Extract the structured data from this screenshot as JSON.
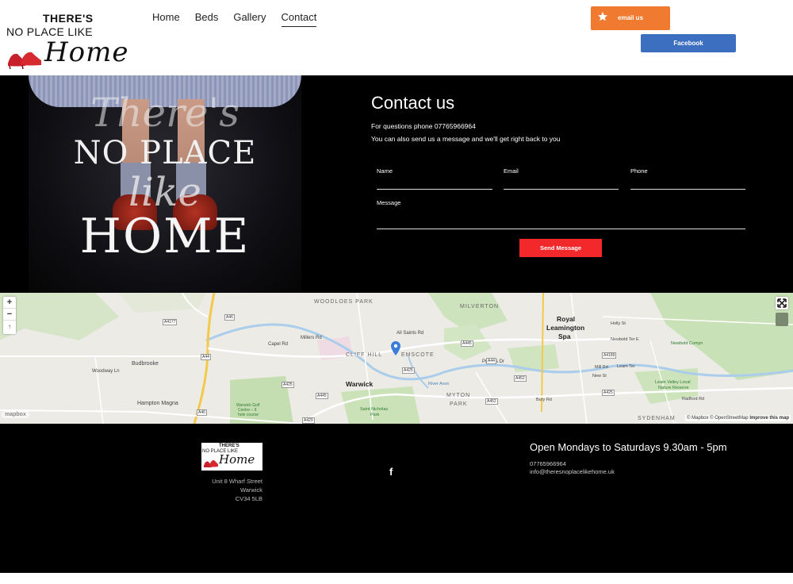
{
  "logo": {
    "line1": "THERE'S",
    "line2": "NO PLACE LIKE",
    "line3": "Home"
  },
  "nav": {
    "items": [
      "Home",
      "Beds",
      "Gallery",
      "Contact"
    ],
    "active": "Contact"
  },
  "header_buttons": {
    "email": "email us",
    "facebook": "Facebook"
  },
  "hero_text": {
    "line1": "There's",
    "line2": "NO PLACE",
    "line3": "like",
    "line4": "HOME"
  },
  "contact": {
    "title": "Contact us",
    "line1": "For questions phone 07765966964",
    "line2": "You can also send us a message and we'll get right back to you",
    "fields": {
      "name": "Name",
      "email": "Email",
      "phone": "Phone",
      "message": "Message"
    },
    "send": "Send Message"
  },
  "map": {
    "places": {
      "woodloes": "WOODLOES PARK",
      "milverton": "MILVERTON",
      "royal": "Royal",
      "leamington": "Leamington",
      "spa": "Spa",
      "cliffhill": "CLIFF HILL",
      "emscote": "EMSCOTE",
      "warwick": "Warwick",
      "budbrooke": "Budbrooke",
      "hamptonmagna": "Hampton Magna",
      "myton": "MYTON",
      "park": "PARK",
      "sydenham": "SYDENHAM",
      "newboldcomyn": "Newbold Comyn",
      "leamvalley": "Leam Valley Local",
      "naturereserve": "Nature Reserve",
      "stnicholas": "Saint Nicholas",
      "stnicholas2": "Park",
      "warwickgolf": "Warwick Golf",
      "warwickgolf2": "Centre – 9",
      "warwickgolf3": "hole course",
      "millersrd": "Millers Rd",
      "capelrd": "Capel Rd",
      "allsaintsrd": "All Saints Rd",
      "princesdr": "Princes Dr",
      "woodloesln": "Woodway Ln",
      "hollyst": "Holly St",
      "newboldterr": "Newbold Ter E",
      "millrd": "Mill Rd",
      "leamterr": "Leam Ter",
      "newst": "New St",
      "buryrd": "Bury Rd",
      "radfordrd": "Radford Rd",
      "riverleam": "River Avon"
    },
    "shields": [
      "A4177",
      "A46",
      "A445",
      "A4189",
      "A425",
      "A452",
      "A44",
      "A429",
      "A46",
      "A452",
      "A445",
      "A425",
      "A425",
      "A44"
    ],
    "zoom_in": "+",
    "zoom_out": "−",
    "compass": "↑",
    "logo": "mapbox",
    "attribution": {
      "a": "© Mapbox",
      "b": "© OpenStreetMap",
      "c": "Improve this map"
    }
  },
  "footer": {
    "logo": {
      "line1": "THERE'S",
      "line2": "NO PLACE LIKE",
      "line3": "Home"
    },
    "address": [
      "Unit 8 Wharf Street",
      "Warwick",
      "CV34 5LB"
    ],
    "facebook_icon": "f",
    "hours": "Open Mondays to Saturdays  9.30am - 5pm",
    "phone": "07765966964",
    "email": "info@theresnoplacelikehome.uk"
  },
  "colors": {
    "email_button": "#f07a2f",
    "facebook_button": "#3d6fc1",
    "send_button": "#f2282b",
    "map_pin": "#3b7dd8"
  }
}
